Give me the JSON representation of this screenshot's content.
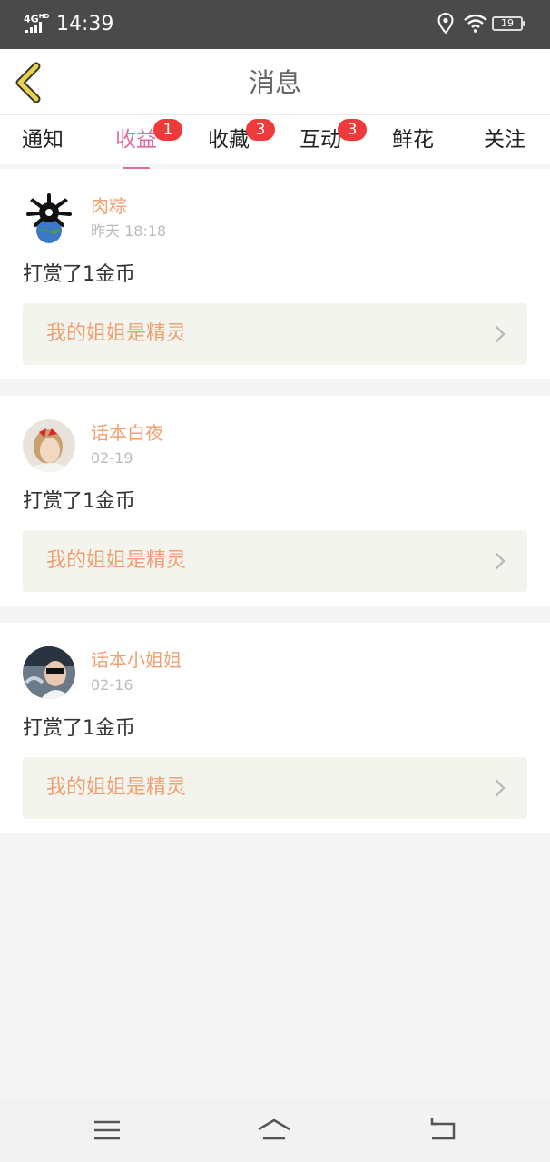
{
  "status_bar": {
    "network": "4G",
    "network_suffix": "HD",
    "time": "14:39",
    "battery": "19"
  },
  "header": {
    "title": "消息",
    "back_icon": "chevron-left-icon"
  },
  "tabs": [
    {
      "label": "通知",
      "badge": "",
      "active": false
    },
    {
      "label": "收益",
      "badge": "1",
      "active": true
    },
    {
      "label": "收藏",
      "badge": "3",
      "active": false
    },
    {
      "label": "互动",
      "badge": "3",
      "active": false
    },
    {
      "label": "鲜花",
      "badge": "",
      "active": false
    },
    {
      "label": "关注",
      "badge": "",
      "active": false
    }
  ],
  "messages": [
    {
      "user": "肉粽",
      "time": "昨天 18:18",
      "action": "打赏了1金币",
      "book": "我的姐姐是精灵"
    },
    {
      "user": "话本白夜",
      "time": "02-19",
      "action": "打赏了1金币",
      "book": "我的姐姐是精灵"
    },
    {
      "user": "话本小姐姐",
      "time": "02-16",
      "action": "打赏了1金币",
      "book": "我的姐姐是精灵"
    }
  ],
  "colors": {
    "accent": "#e06aa0",
    "username": "#f0a070",
    "badge": "#ee3a3a",
    "back_icon": "#e8d24a"
  },
  "nav": {
    "menu_icon": "menu-icon",
    "home_icon": "home-icon",
    "back_icon": "return-icon"
  }
}
